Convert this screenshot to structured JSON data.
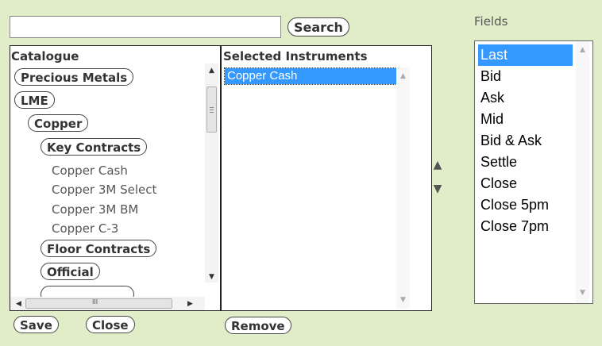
{
  "search": {
    "value": "",
    "button_label": "Search"
  },
  "fields_label": "Fields",
  "catalogue": {
    "header": "Catalogue",
    "nodes": [
      "Precious Metals",
      "LME",
      "Copper",
      "Key Contracts"
    ],
    "leaves": [
      "Copper Cash",
      "Copper 3M Select",
      "Copper 3M BM",
      "Copper C-3"
    ],
    "nodes2": [
      "Floor Contracts",
      "Official"
    ]
  },
  "selected": {
    "header": "Selected Instruments",
    "items": [
      "Copper Cash"
    ]
  },
  "fields": {
    "items": [
      "Last",
      "Bid",
      "Ask",
      "Mid",
      "Bid & Ask",
      "Settle",
      "Close",
      "Close 5pm",
      "Close 7pm"
    ],
    "selected": "Last"
  },
  "buttons": {
    "save": "Save",
    "close": "Close",
    "remove": "Remove"
  },
  "icons": {
    "up": "▲",
    "down": "▼",
    "scroll_up": "▲",
    "scroll_down": "▼",
    "scroll_left": "◀",
    "scroll_right": "▶",
    "grip": "III"
  },
  "colors": {
    "background": "#e1ecc8",
    "selection": "#3399ff"
  }
}
